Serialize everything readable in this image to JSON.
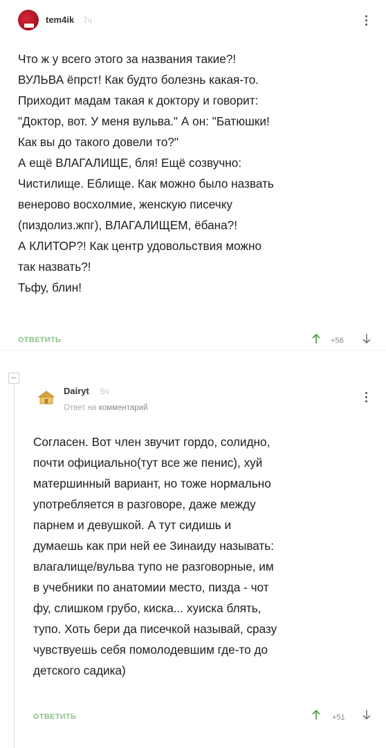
{
  "comment1": {
    "username": "tem4ik",
    "time": "7ч",
    "text": "Что ж у всего этого за названия такие?!\nВУЛЬВА ёпрст! Как будто болезнь какая-то.\nПриходит мадам такая к доктору и говорит:\n\"Доктор, вот. У меня вульва.\" А он: \"Батюшки!\nКак вы до такого довели то?\"\nА ещё ВЛАГАЛИЩЕ, бля! Ещё созвучно:\nЧистилище. Еблище. Как можно было назвать\nвенерово восхолмие, женскую писечку\n(пиздолиз.жпг), ВЛАГАЛИЩЕМ, ёбана?!\nА КЛИТОР?! Как центр удовольствия можно\nтак назвать?!\nТьфу, блин!",
    "reply_label": "ОТВЕТИТЬ",
    "score": "+58"
  },
  "comment2": {
    "username": "Dairyt",
    "time": "5ч",
    "reply_prefix": "Ответ на",
    "reply_target": "комментарий",
    "text": "Согласен. Вот член звучит гордо, солидно,\nпочти официально(тут все же пенис), хуй\nматершинный вариант, но тоже нормально\nупотребляется в разговоре, даже между\nпарнем и девушкой. А тут сидишь и\nдумаешь как при ней ее Зинаиду называть:\nвлагалище/вульва тупо не разговорные, им\nв учебники по анатомии место, пизда - чот\nфу, слишком грубо, киска... хуиска блять,\nтупо. Хоть бери да писечкой называй, сразу\nчувствуешь себя помолодевшим где-то до\nдетского садика)",
    "reply_label": "ОТВЕТИТЬ",
    "score": "+51"
  },
  "icons": {
    "more": "more-vertical-icon",
    "upvote": "arrow-up-icon",
    "downvote": "arrow-down-icon",
    "collapse": "minus-icon"
  },
  "colors": {
    "reply_link": "#8fc28a",
    "upvote": "#4a9a3c",
    "time": "#c7c7c7"
  }
}
